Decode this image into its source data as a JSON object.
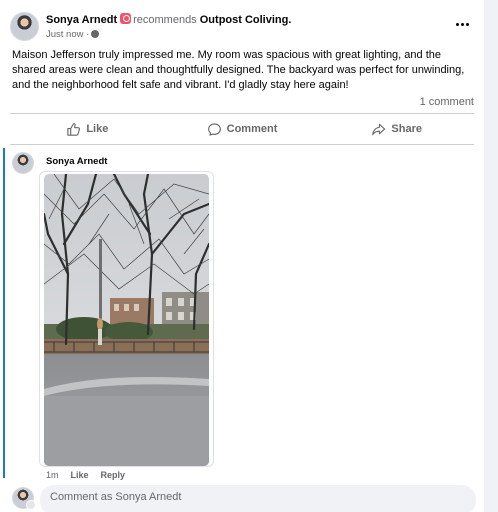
{
  "post": {
    "author": "Sonya Arnedt",
    "recommend_text": "recommends",
    "page_name": "Outpost Coliving.",
    "time": "Just now ·",
    "text": "Maison Jefferson truly impressed me. My room was spacious with great lighting, and the shared areas were clean and thoughtfully designed. The backyard was perfect for unwinding, and the neighborhood felt safe and vibrant. I'd gladly stay here again!",
    "comment_count": "1 comment"
  },
  "actions": {
    "like": "Like",
    "comment": "Comment",
    "share": "Share"
  },
  "comment": {
    "author": "Sonya Arnedt",
    "time": "1m",
    "like": "Like",
    "reply": "Reply"
  },
  "composer": {
    "placeholder": "Comment as Sonya Arnedt"
  },
  "colors": {
    "accent": "#1b74e4",
    "recommend": "#f25268",
    "secondary_text": "#65676b"
  }
}
